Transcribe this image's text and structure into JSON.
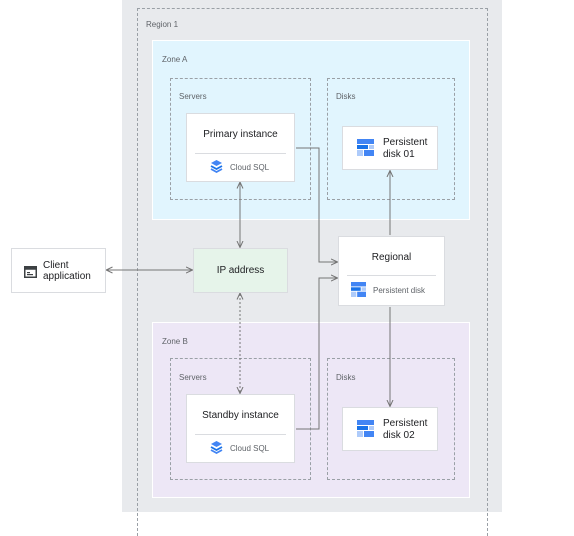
{
  "region": {
    "label": "Region 1"
  },
  "zone_a": {
    "label": "Zone A",
    "servers_label": "Servers",
    "disks_label": "Disks",
    "primary": {
      "title": "Primary instance",
      "sub": "Cloud SQL"
    },
    "disk": {
      "line1": "Persistent",
      "line2": "disk 01"
    }
  },
  "zone_b": {
    "label": "Zone B",
    "servers_label": "Servers",
    "disks_label": "Disks",
    "standby": {
      "title": "Standby instance",
      "sub": "Cloud SQL"
    },
    "disk": {
      "line1": "Persistent",
      "line2": "disk 02"
    }
  },
  "client": {
    "line1": "Client",
    "line2": "application"
  },
  "ip": {
    "label": "IP address"
  },
  "regional": {
    "title": "Regional",
    "sub": "Persistent disk"
  },
  "colors": {
    "icon_blue": "#4285f4",
    "icon_dark": "#1a73e8",
    "arrow": "#757575"
  },
  "icons": {
    "cloud_sql": "cloud-sql-icon",
    "persistent_disk": "persistent-disk-icon",
    "app": "app-window-icon"
  }
}
